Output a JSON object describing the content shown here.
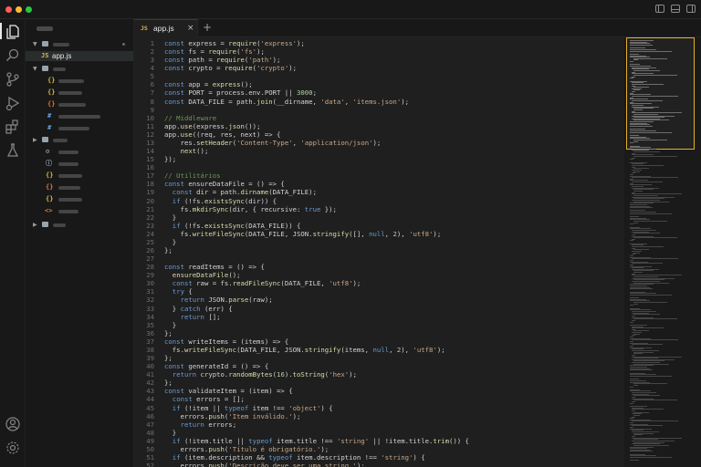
{
  "window": {
    "traffic_lights": {
      "close": "#ff5f57",
      "minimize": "#febc2e",
      "zoom": "#28c840"
    }
  },
  "activity_bar": {
    "top": [
      "explorer-icon",
      "search-icon",
      "source-control-icon",
      "run-debug-icon",
      "extensions-icon",
      "testing-icon"
    ],
    "bottom": [
      "account-icon",
      "settings-icon"
    ],
    "active": "explorer-icon"
  },
  "explorer": {
    "open_file": "app.js",
    "file_icon_colors": {
      "json": "#d7b74c",
      "css": "#6aa7e8",
      "js": "#d7b74c",
      "html": "#e37933",
      "config": "#9aa3ad"
    }
  },
  "tabs": [
    {
      "icon_text": "JS",
      "label": "app.js",
      "close": "×"
    }
  ],
  "tab_add": "+",
  "editor": {
    "lines": [
      "const express = require('express');",
      "const fs = require('fs');",
      "const path = require('path');",
      "const crypto = require('crypto');",
      "",
      "const app = express();",
      "const PORT = process.env.PORT || 3000;",
      "const DATA_FILE = path.join(__dirname, 'data', 'items.json');",
      "",
      "// Middleware",
      "app.use(express.json());",
      "app.use((req, res, next) => {",
      "    res.setHeader('Content-Type', 'application/json');",
      "    next();",
      "});",
      "",
      "// Utilitários",
      "const ensureDataFile = () => {",
      "  const dir = path.dirname(DATA_FILE);",
      "  if (!fs.existsSync(dir)) {",
      "    fs.mkdirSync(dir, { recursive: true });",
      "  }",
      "  if (!fs.existsSync(DATA_FILE)) {",
      "    fs.writeFileSync(DATA_FILE, JSON.stringify([], null, 2), 'utf8');",
      "  }",
      "};",
      "",
      "const readItems = () => {",
      "  ensureDataFile();",
      "  const raw = fs.readFileSync(DATA_FILE, 'utf8');",
      "  try {",
      "    return JSON.parse(raw);",
      "  } catch (err) {",
      "    return [];",
      "  }",
      "};",
      "const writeItems = (items) => {",
      "  fs.writeFileSync(DATA_FILE, JSON.stringify(items, null, 2), 'utf8');",
      "};",
      "const generateId = () => {",
      "  return crypto.randomBytes(16).toString('hex');",
      "};",
      "const validateItem = (item) => {",
      "  const errors = [];",
      "  if (!item || typeof item !== 'object') {",
      "    errors.push('Item inválido.');",
      "    return errors;",
      "  }",
      "  if (!item.title || typeof item.title !== 'string' || !item.title.trim()) {",
      "    errors.push('Título é obrigatório.');",
      "  if (item.description && typeof item.description !== 'string') {",
      "    errors.push('Descrição deve ser uma string.');",
      "  if (typeof item.completed !== 'boolean') {",
      "    errors.push('Campo \"completed\" deve ser booleano.');"
    ]
  },
  "theme": {
    "keyword": "#6b9bd1",
    "string": "#c9a98a",
    "comment": "#6a9955",
    "number": "#b5cea8",
    "function": "#dcdcaa",
    "minimap_viewport": "#e3b12a"
  }
}
